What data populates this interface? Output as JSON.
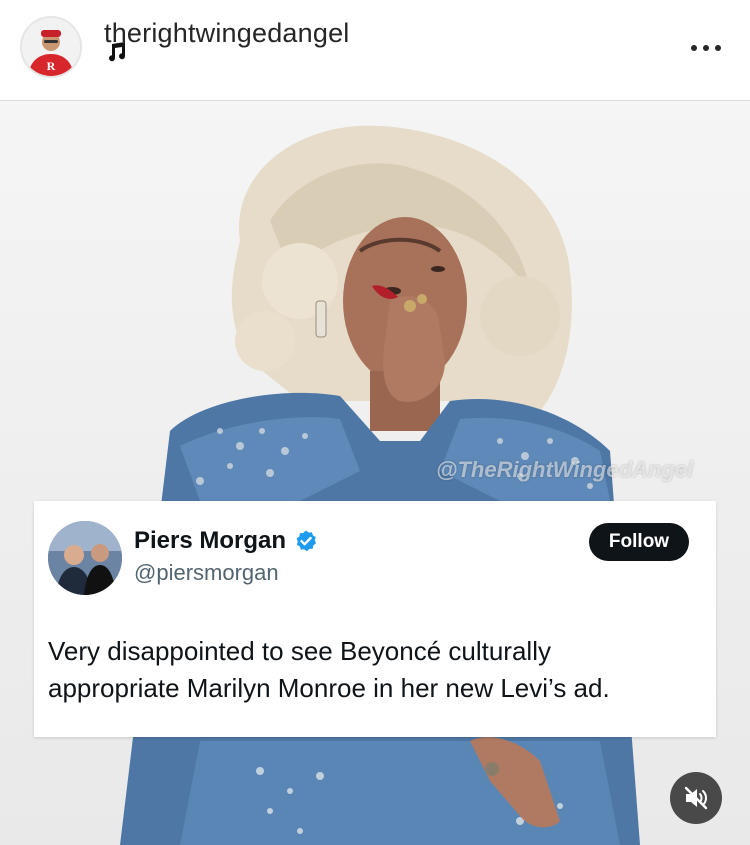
{
  "post": {
    "username": "therightwingedangel",
    "avatar_icon": "profile-avatar",
    "music_icon": "music-note-icon",
    "more_icon": "more-options-icon"
  },
  "media": {
    "watermark": "@TheRightWingedAngel"
  },
  "tweet": {
    "name": "Piers Morgan",
    "handle": "@piersmorgan",
    "follow_label": "Follow",
    "text": "Very disappointed to see Beyoncé culturally appropriate Marilyn Monroe in her new Levi’s ad.",
    "verified_color": "#1d9bf0"
  },
  "controls": {
    "mute_icon": "muted-speaker-icon"
  }
}
